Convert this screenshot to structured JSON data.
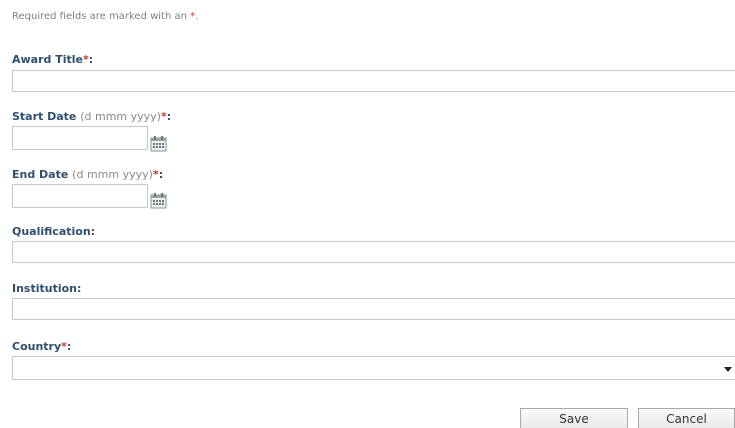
{
  "required_note": {
    "text": "Required fields are marked with an ",
    "marker": "*",
    "end": "."
  },
  "fields": {
    "award_title": {
      "label": "Award Title",
      "required_marker": "*",
      "colon": ":",
      "value": ""
    },
    "start_date": {
      "label": "Start Date",
      "hint": "(d mmm yyyy)",
      "required_marker": "*",
      "colon": ":",
      "value": ""
    },
    "end_date": {
      "label": "End Date",
      "hint": "(d mmm yyyy)",
      "required_marker": "*",
      "colon": ":",
      "value": ""
    },
    "qualification": {
      "label": "Qualification:",
      "value": ""
    },
    "institution": {
      "label": "Institution:",
      "value": ""
    },
    "country": {
      "label": "Country",
      "required_marker": "*",
      "colon": ":",
      "selected": ""
    }
  },
  "buttons": {
    "save": "Save",
    "cancel": "Cancel"
  },
  "icons": {
    "calendar": "calendar-icon",
    "dropdown": "chevron-down-icon"
  },
  "colors": {
    "required": "#c0392b",
    "label": "#2f4f6f",
    "hint": "#8a8a8a",
    "border": "#c8c8c8"
  }
}
